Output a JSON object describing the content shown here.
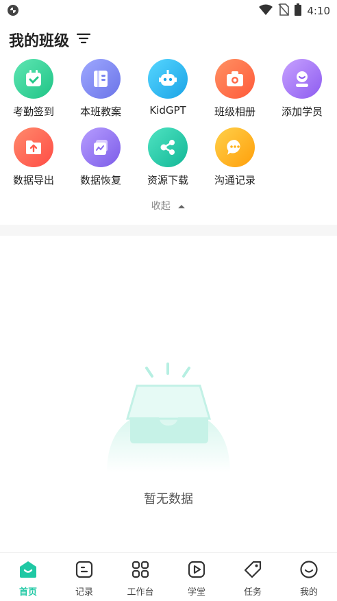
{
  "status_bar": {
    "time": "4:10"
  },
  "header": {
    "title": "我的班级"
  },
  "grid": {
    "items": [
      {
        "label": "考勤签到",
        "icon": "calendar-check-icon",
        "color": "#2fd18d"
      },
      {
        "label": "本班教案",
        "icon": "lesson-plan-icon",
        "color": "#7b86f0"
      },
      {
        "label": "KidGPT",
        "icon": "robot-icon",
        "color": "#22b7ea"
      },
      {
        "label": "班级相册",
        "icon": "camera-icon",
        "color": "#ff6a4a"
      },
      {
        "label": "添加学员",
        "icon": "add-student-icon",
        "color": "#a06cf2"
      },
      {
        "label": "数据导出",
        "icon": "export-icon",
        "color": "#ff5a4b"
      },
      {
        "label": "数据恢复",
        "icon": "restore-icon",
        "color": "#9a6ef0"
      },
      {
        "label": "资源下载",
        "icon": "share-nodes-icon",
        "color": "#22c9a8"
      },
      {
        "label": "沟通记录",
        "icon": "chat-bubble-icon",
        "color": "#ffb21a"
      }
    ]
  },
  "collapse": {
    "label": "收起"
  },
  "empty": {
    "text": "暂无数据"
  },
  "tabbar": {
    "tabs": [
      {
        "label": "首页",
        "icon": "home-icon",
        "active": true
      },
      {
        "label": "记录",
        "icon": "record-icon",
        "active": false
      },
      {
        "label": "工作台",
        "icon": "workbench-icon",
        "active": false
      },
      {
        "label": "学堂",
        "icon": "play-icon",
        "active": false
      },
      {
        "label": "任务",
        "icon": "tag-icon",
        "active": false
      },
      {
        "label": "我的",
        "icon": "smile-icon",
        "active": false
      }
    ],
    "accent": "#1fc8a4"
  }
}
